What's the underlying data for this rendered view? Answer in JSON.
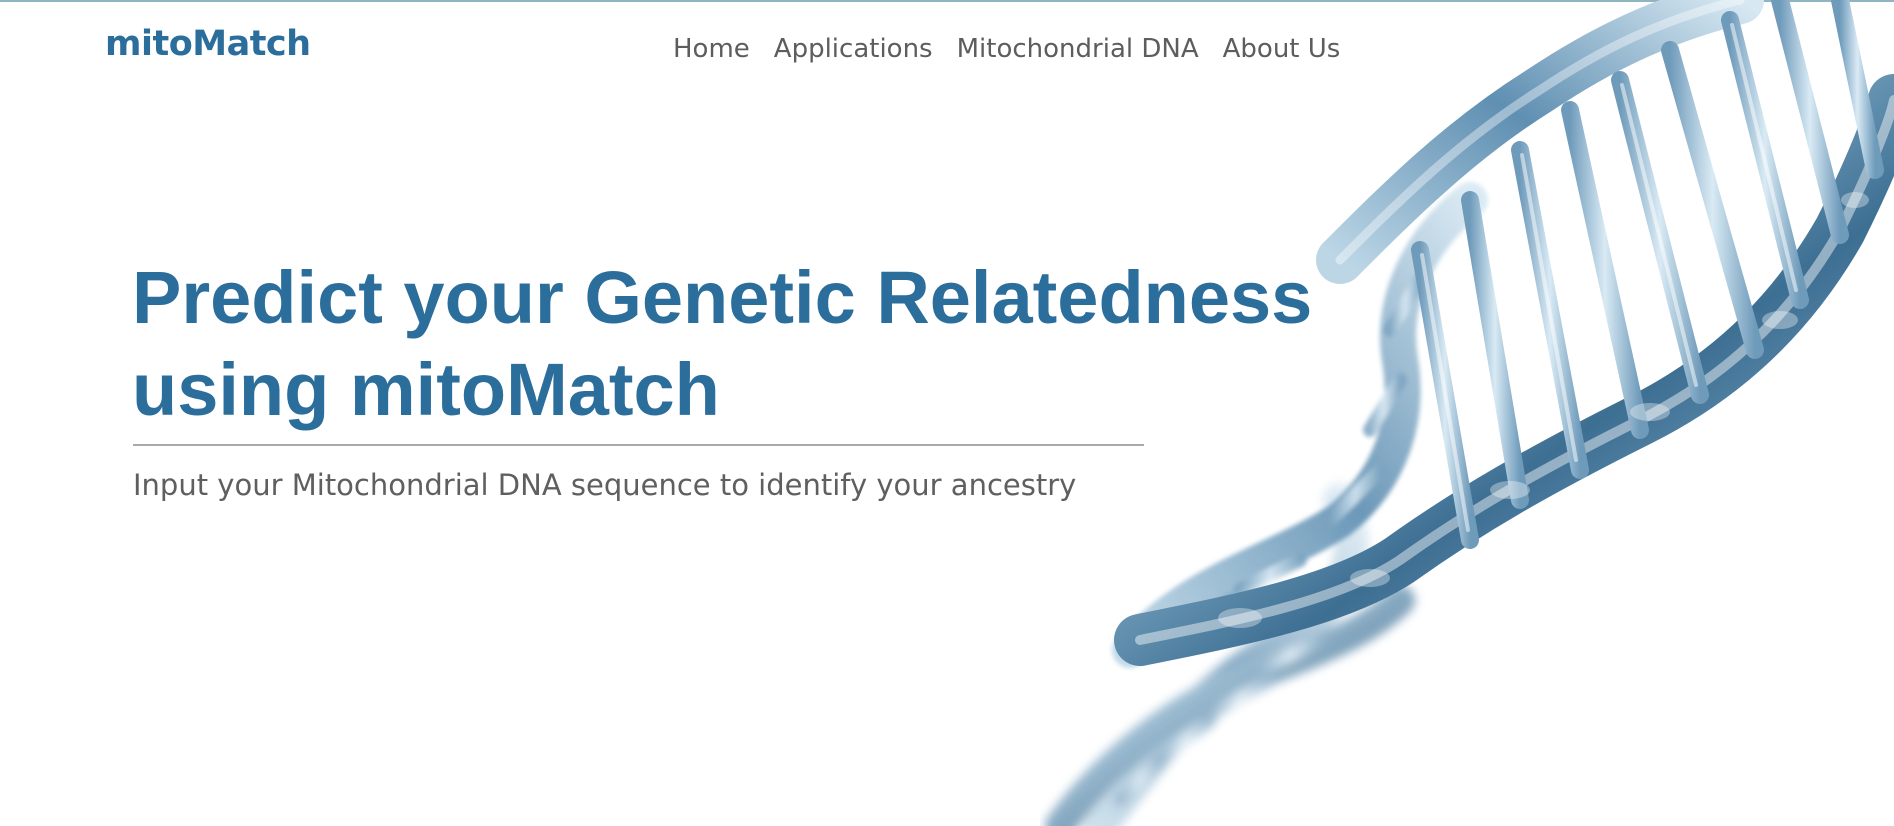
{
  "header": {
    "logo_text": "mitoMatch",
    "nav": [
      {
        "label": "Home"
      },
      {
        "label": "Applications"
      },
      {
        "label": "Mitochondrial DNA"
      },
      {
        "label": "About Us"
      }
    ]
  },
  "hero": {
    "title_line1": "Predict your Genetic Relatedness",
    "title_line2": "using mitoMatch",
    "subtitle": "Input your Mitochondrial DNA sequence to identify your ancestry",
    "image": "dna-double-helix-illustration"
  },
  "colors": {
    "brand": "#2b6e9c",
    "nav_text": "#5d5d5d",
    "subtitle_text": "#5f5f5f",
    "divider": "#a9a9a9",
    "helix_light": "#cfe3ef",
    "helix_mid": "#7fa9c6",
    "helix_dark": "#2f5f82"
  }
}
